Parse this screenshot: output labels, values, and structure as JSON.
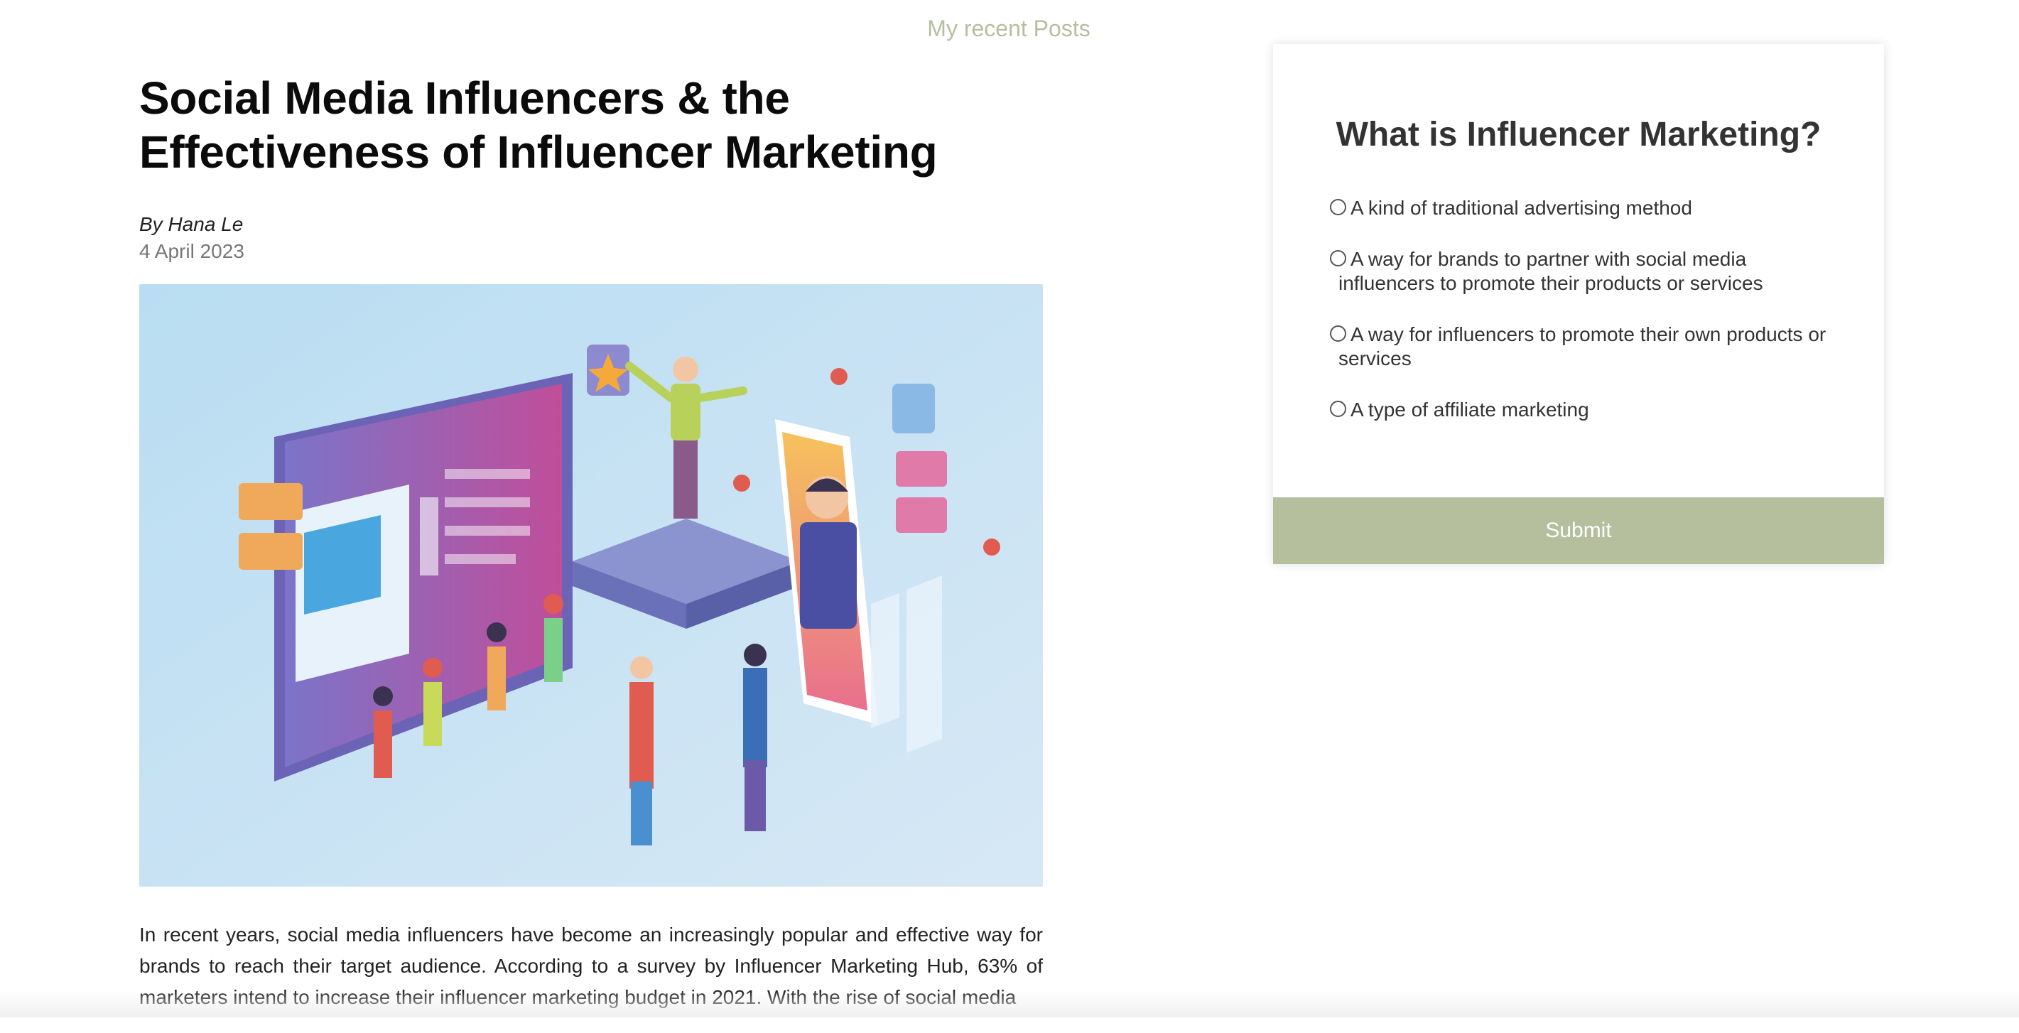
{
  "nav": {
    "recent_posts_label": "My recent Posts"
  },
  "article": {
    "title_line1": "Social Media Influencers & the",
    "title_line2": "Effectiveness of Influencer Marketing",
    "byline": "By Hana Le",
    "date": "4 April 2023",
    "body": "In recent years, social media influencers have become an increasingly popular and effective way for brands to reach their target audience. According to a survey by Influencer Marketing Hub, 63% of marketers intend to increase their influencer marketing budget in 2021. With the rise of social media"
  },
  "quiz": {
    "title": "What is Influencer Marketing?",
    "options": [
      "A kind of traditional advertising method",
      "A way for brands to partner with social media influencers to promote their products or services",
      "A way for influencers to promote their own products or services",
      "A type of affiliate marketing"
    ],
    "submit_label": "Submit"
  },
  "colors": {
    "accent": "#b5bf9e",
    "text": "#222222",
    "muted": "#777777"
  },
  "icons": {
    "option_marker": "radio-circle-icon"
  }
}
